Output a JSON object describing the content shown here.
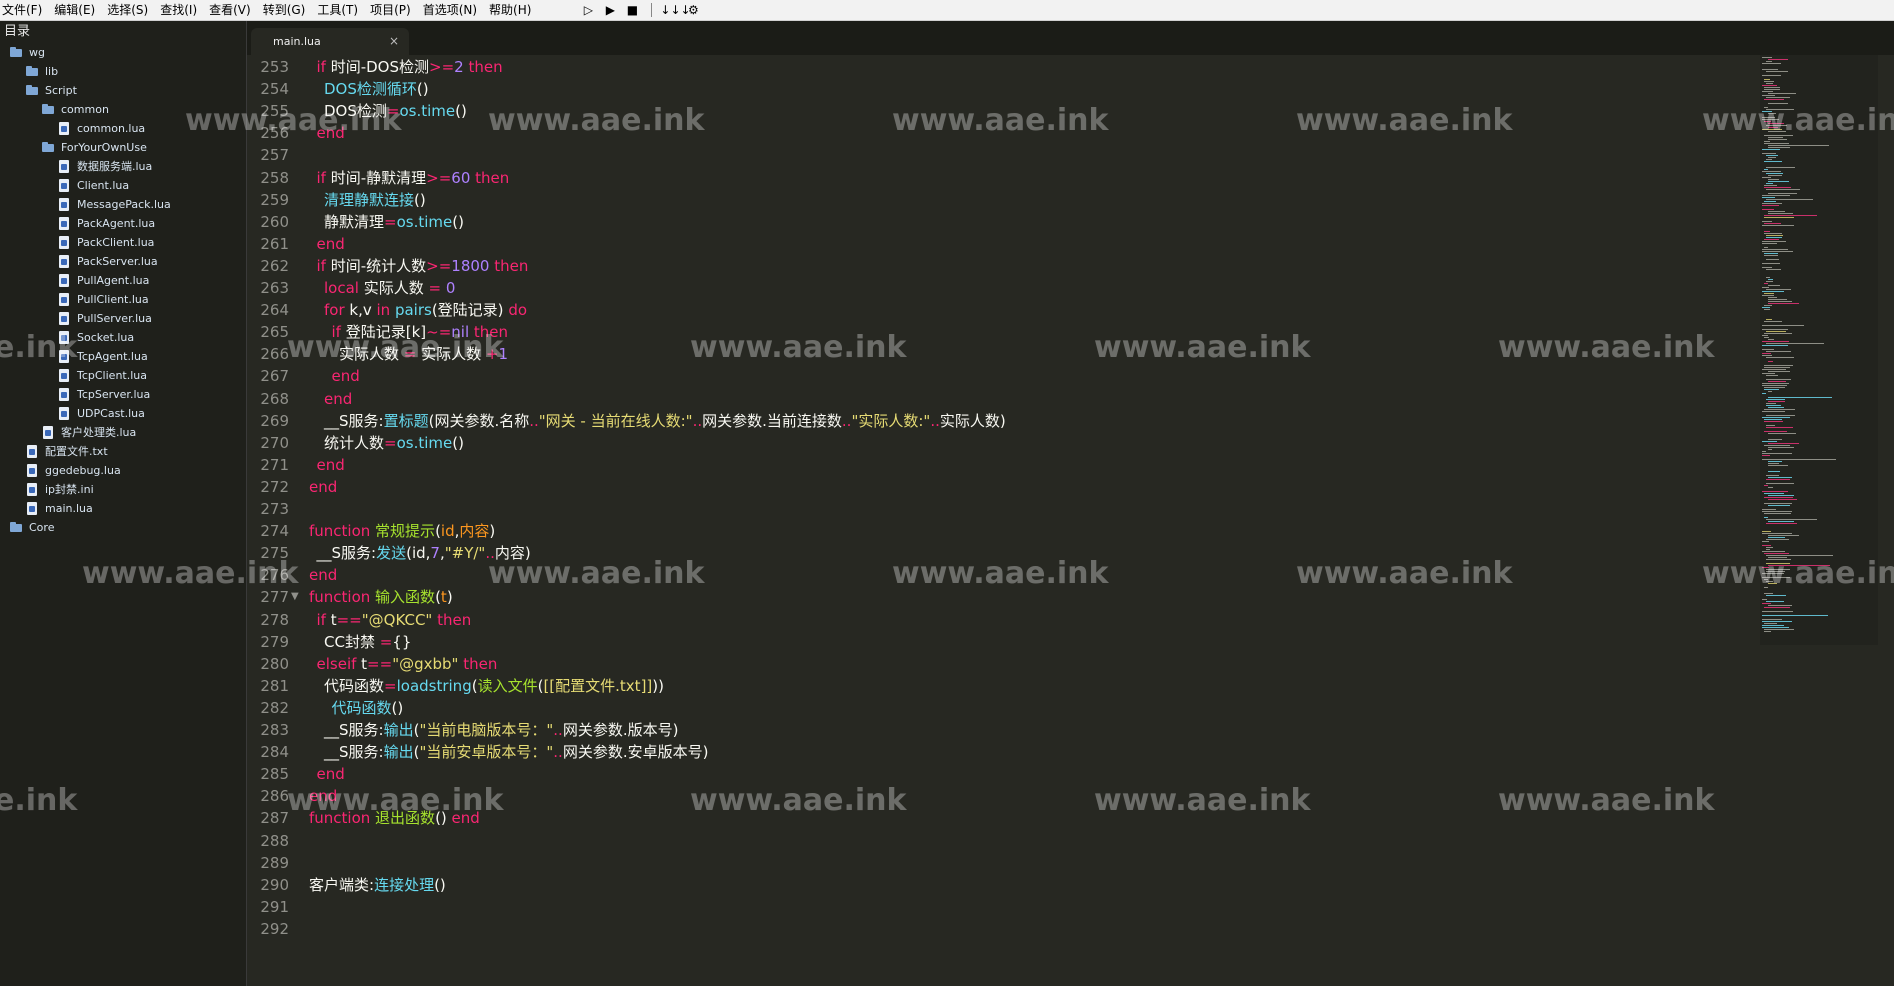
{
  "menubar": {
    "items": [
      "文件(F)",
      "编辑(E)",
      "选择(S)",
      "查找(I)",
      "查看(V)",
      "转到(G)",
      "工具(T)",
      "项目(P)",
      "首选项(N)",
      "帮助(H)"
    ],
    "toolbar": [
      {
        "icon": "run-outline-icon",
        "glyph": "▷"
      },
      {
        "icon": "play-icon",
        "glyph": "▶"
      },
      {
        "icon": "stop-icon",
        "glyph": "■"
      },
      {
        "icon": "cursor-separator-icon",
        "glyph": ""
      },
      {
        "icon": "step-down-icon",
        "glyph": "↓↓↓"
      },
      {
        "icon": "gear-icon",
        "glyph": "⚙"
      }
    ]
  },
  "sidebar": {
    "title": "目录",
    "items": [
      {
        "label": "wg",
        "type": "folder",
        "depth": 0
      },
      {
        "label": "lib",
        "type": "folder",
        "depth": 1
      },
      {
        "label": "Script",
        "type": "folder",
        "depth": 1
      },
      {
        "label": "common",
        "type": "folder",
        "depth": 2
      },
      {
        "label": "common.lua",
        "type": "file",
        "depth": 3
      },
      {
        "label": "ForYourOwnUse",
        "type": "folder",
        "depth": 2
      },
      {
        "label": "数据服务端.lua",
        "type": "file",
        "depth": 3
      },
      {
        "label": "Client.lua",
        "type": "file",
        "depth": 3
      },
      {
        "label": "MessagePack.lua",
        "type": "file",
        "depth": 3
      },
      {
        "label": "PackAgent.lua",
        "type": "file",
        "depth": 3
      },
      {
        "label": "PackClient.lua",
        "type": "file",
        "depth": 3
      },
      {
        "label": "PackServer.lua",
        "type": "file",
        "depth": 3
      },
      {
        "label": "PullAgent.lua",
        "type": "file",
        "depth": 3
      },
      {
        "label": "PullClient.lua",
        "type": "file",
        "depth": 3
      },
      {
        "label": "PullServer.lua",
        "type": "file",
        "depth": 3
      },
      {
        "label": "Socket.lua",
        "type": "file",
        "depth": 3
      },
      {
        "label": "TcpAgent.lua",
        "type": "file",
        "depth": 3
      },
      {
        "label": "TcpClient.lua",
        "type": "file",
        "depth": 3
      },
      {
        "label": "TcpServer.lua",
        "type": "file",
        "depth": 3
      },
      {
        "label": "UDPCast.lua",
        "type": "file",
        "depth": 3
      },
      {
        "label": "客户处理类.lua",
        "type": "file",
        "depth": 2
      },
      {
        "label": "配置文件.txt",
        "type": "file",
        "depth": 1
      },
      {
        "label": "ggedebug.lua",
        "type": "file",
        "depth": 1
      },
      {
        "label": "ip封禁.ini",
        "type": "file",
        "depth": 1
      },
      {
        "label": "main.lua",
        "type": "file",
        "depth": 1
      },
      {
        "label": "Core",
        "type": "folder",
        "depth": 0
      }
    ]
  },
  "tabs": [
    {
      "label": "main.lua",
      "close": "×"
    }
  ],
  "editor": {
    "lines": [
      {
        "n": "253",
        "indent": 1,
        "tokens": [
          [
            "k",
            "if"
          ],
          [
            "t",
            " 时间-DOS检测"
          ],
          [
            "o",
            ">="
          ],
          [
            "n",
            "2"
          ],
          [
            "k",
            " then"
          ]
        ]
      },
      {
        "n": "254",
        "indent": 2,
        "tokens": [
          [
            "f",
            "DOS检测循环"
          ],
          [
            "t",
            "()"
          ]
        ]
      },
      {
        "n": "255",
        "indent": 2,
        "tokens": [
          [
            "t",
            "DOS检测"
          ],
          [
            "o",
            "="
          ],
          [
            "f",
            "os.time"
          ],
          [
            "t",
            "()"
          ]
        ]
      },
      {
        "n": "256",
        "indent": 1,
        "tokens": [
          [
            "k",
            "end"
          ]
        ]
      },
      {
        "n": "257",
        "indent": 0,
        "tokens": []
      },
      {
        "n": "258",
        "indent": 1,
        "tokens": [
          [
            "k",
            "if"
          ],
          [
            "t",
            " 时间-静默清理"
          ],
          [
            "o",
            ">="
          ],
          [
            "n",
            "60"
          ],
          [
            "k",
            " then"
          ]
        ]
      },
      {
        "n": "259",
        "indent": 2,
        "tokens": [
          [
            "f",
            "清理静默连接"
          ],
          [
            "t",
            "()"
          ]
        ]
      },
      {
        "n": "260",
        "indent": 2,
        "tokens": [
          [
            "t",
            "静默清理"
          ],
          [
            "o",
            "="
          ],
          [
            "f",
            "os.time"
          ],
          [
            "t",
            "()"
          ]
        ]
      },
      {
        "n": "261",
        "indent": 1,
        "tokens": [
          [
            "k",
            "end"
          ]
        ]
      },
      {
        "n": "262",
        "indent": 1,
        "tokens": [
          [
            "k",
            "if"
          ],
          [
            "t",
            " 时间-统计人数"
          ],
          [
            "o",
            ">="
          ],
          [
            "n",
            "1800"
          ],
          [
            "k",
            " then"
          ]
        ]
      },
      {
        "n": "263",
        "indent": 2,
        "tokens": [
          [
            "k",
            "local"
          ],
          [
            "t",
            " 实际人数 "
          ],
          [
            "o",
            "="
          ],
          [
            "n",
            " 0"
          ]
        ]
      },
      {
        "n": "264",
        "indent": 2,
        "tokens": [
          [
            "k",
            "for"
          ],
          [
            "t",
            " k,v "
          ],
          [
            "k",
            "in"
          ],
          [
            "f",
            " pairs"
          ],
          [
            "t",
            "(登陆记录) "
          ],
          [
            "k",
            "do"
          ]
        ]
      },
      {
        "n": "265",
        "indent": 3,
        "tokens": [
          [
            "k",
            "if"
          ],
          [
            "t",
            " 登陆记录[k]"
          ],
          [
            "o",
            "~="
          ],
          [
            "n",
            "nil"
          ],
          [
            "k",
            " then"
          ]
        ]
      },
      {
        "n": "266",
        "indent": 4,
        "tokens": [
          [
            "t",
            "实际人数 "
          ],
          [
            "o",
            "="
          ],
          [
            "t",
            " 实际人数 "
          ],
          [
            "o",
            "+"
          ],
          [
            "n",
            "1"
          ]
        ]
      },
      {
        "n": "267",
        "indent": 3,
        "tokens": [
          [
            "k",
            "end"
          ]
        ]
      },
      {
        "n": "268",
        "indent": 2,
        "tokens": [
          [
            "k",
            "end"
          ]
        ]
      },
      {
        "n": "269",
        "indent": 2,
        "tokens": [
          [
            "t",
            "__S服务:"
          ],
          [
            "f",
            "置标题"
          ],
          [
            "t",
            "(网关参数.名称"
          ],
          [
            "o",
            ".."
          ],
          [
            "s",
            "\"网关 - 当前在线人数:\""
          ],
          [
            "o",
            ".."
          ],
          [
            "t",
            "网关参数.当前连接数"
          ],
          [
            "o",
            ".."
          ],
          [
            "s",
            "\"实际人数:\""
          ],
          [
            "o",
            ".."
          ],
          [
            "t",
            "实际人数)"
          ]
        ]
      },
      {
        "n": "270",
        "indent": 2,
        "tokens": [
          [
            "t",
            "统计人数"
          ],
          [
            "o",
            "="
          ],
          [
            "f",
            "os.time"
          ],
          [
            "t",
            "()"
          ]
        ]
      },
      {
        "n": "271",
        "indent": 1,
        "tokens": [
          [
            "k",
            "end"
          ]
        ]
      },
      {
        "n": "272",
        "indent": 0,
        "tokens": [
          [
            "k",
            "end"
          ]
        ]
      },
      {
        "n": "273",
        "indent": 0,
        "tokens": []
      },
      {
        "n": "274",
        "indent": 0,
        "tokens": [
          [
            "k",
            "function"
          ],
          [
            "fn",
            " 常规提示"
          ],
          [
            "t",
            "("
          ],
          [
            "p",
            "id"
          ],
          [
            "t",
            ","
          ],
          [
            "p",
            "内容"
          ],
          [
            "t",
            ")"
          ]
        ]
      },
      {
        "n": "275",
        "indent": 1,
        "tokens": [
          [
            "t",
            "__S服务:"
          ],
          [
            "f",
            "发送"
          ],
          [
            "t",
            "(id,"
          ],
          [
            "n",
            "7"
          ],
          [
            "t",
            ","
          ],
          [
            "s",
            "\"#Y/\""
          ],
          [
            "o",
            ".."
          ],
          [
            "t",
            "内容)"
          ]
        ]
      },
      {
        "n": "276",
        "indent": 0,
        "tokens": [
          [
            "k",
            "end"
          ]
        ]
      },
      {
        "n": "277",
        "indent": 0,
        "fold": "▼",
        "tokens": [
          [
            "k",
            "function"
          ],
          [
            "fn",
            " 输入函数"
          ],
          [
            "t",
            "("
          ],
          [
            "p",
            "t"
          ],
          [
            "t",
            ")"
          ]
        ]
      },
      {
        "n": "278",
        "indent": 1,
        "tokens": [
          [
            "k",
            "if"
          ],
          [
            "t",
            " t"
          ],
          [
            "o",
            "=="
          ],
          [
            "s",
            "\"@QKCC\""
          ],
          [
            "k",
            " then"
          ]
        ]
      },
      {
        "n": "279",
        "indent": 2,
        "tokens": [
          [
            "t",
            "CC封禁 "
          ],
          [
            "o",
            "="
          ],
          [
            "t",
            "{}"
          ]
        ]
      },
      {
        "n": "280",
        "indent": 1,
        "tokens": [
          [
            "k",
            "elseif"
          ],
          [
            "t",
            " t"
          ],
          [
            "o",
            "=="
          ],
          [
            "s",
            "\"@gxbb\""
          ],
          [
            "k",
            " then"
          ]
        ]
      },
      {
        "n": "281",
        "indent": 2,
        "tokens": [
          [
            "t",
            "代码函数"
          ],
          [
            "o",
            "="
          ],
          [
            "f",
            "loadstring"
          ],
          [
            "t",
            "("
          ],
          [
            "fn",
            "读入文件"
          ],
          [
            "t",
            "("
          ],
          [
            "s",
            "[[配置文件.txt]]"
          ],
          [
            "t",
            "))"
          ]
        ]
      },
      {
        "n": "282",
        "indent": 3,
        "tokens": [
          [
            "f",
            "代码函数"
          ],
          [
            "t",
            "()"
          ]
        ]
      },
      {
        "n": "283",
        "indent": 2,
        "tokens": [
          [
            "t",
            "__S服务:"
          ],
          [
            "f",
            "输出"
          ],
          [
            "t",
            "("
          ],
          [
            "s",
            "\"当前电脑版本号：\""
          ],
          [
            "o",
            ".."
          ],
          [
            "t",
            "网关参数.版本号)"
          ]
        ]
      },
      {
        "n": "284",
        "indent": 2,
        "tokens": [
          [
            "t",
            "__S服务:"
          ],
          [
            "f",
            "输出"
          ],
          [
            "t",
            "("
          ],
          [
            "s",
            "\"当前安卓版本号：\""
          ],
          [
            "o",
            ".."
          ],
          [
            "t",
            "网关参数.安卓版本号)"
          ]
        ]
      },
      {
        "n": "285",
        "indent": 1,
        "tokens": [
          [
            "k",
            "end"
          ]
        ]
      },
      {
        "n": "286",
        "indent": 0,
        "tokens": [
          [
            "k",
            "end"
          ]
        ]
      },
      {
        "n": "287",
        "indent": 0,
        "tokens": [
          [
            "k",
            "function"
          ],
          [
            "fn",
            " 退出函数"
          ],
          [
            "t",
            "() "
          ],
          [
            "k",
            "end"
          ]
        ]
      },
      {
        "n": "288",
        "indent": 0,
        "tokens": []
      },
      {
        "n": "289",
        "indent": 0,
        "tokens": []
      },
      {
        "n": "290",
        "indent": 0,
        "tokens": [
          [
            "t",
            "客户端类:"
          ],
          [
            "f",
            "连接处理"
          ],
          [
            "t",
            "()"
          ]
        ]
      },
      {
        "n": "291",
        "indent": 0,
        "tokens": []
      },
      {
        "n": "292",
        "indent": 0,
        "tokens": []
      }
    ]
  },
  "watermark": {
    "text_full": "www.aae.ink",
    "text_left_cut": "e.ink",
    "text_right_cut": "www.aae.ink"
  },
  "colors": {
    "background": "#272822",
    "keyword": "#f92672",
    "builtin": "#66d9ef",
    "function_name": "#a6e22e",
    "string": "#e6db74",
    "number": "#ae81ff",
    "param": "#fd971f",
    "text": "#f8f8f2",
    "line_number": "#90908a"
  }
}
